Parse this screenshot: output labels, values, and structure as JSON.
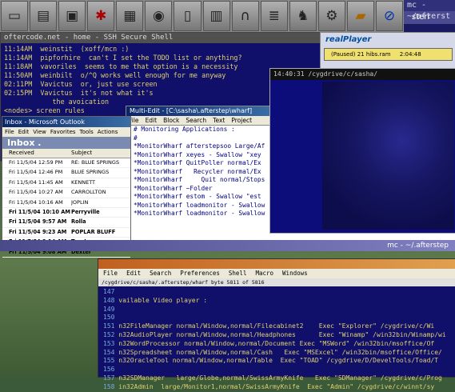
{
  "wharf": {
    "icons": [
      "terminal-icon",
      "drive-icon",
      "monitor-icon",
      "bug-icon",
      "chip-icon",
      "media-icon",
      "document-icon",
      "printer-icon",
      "headphones-icon",
      "notepad-icon",
      "wizard-icon",
      "gear-icon",
      "folder-icon",
      "globe-icon",
      "shield-icon"
    ]
  },
  "mc_top": {
    "title": "mc - ~/afterst",
    "sub": "sterr"
  },
  "ssh": {
    "title": "oftercode.net - home - SSH Secure Shell",
    "lines": [
      "11:14AM  weinstit  (xoff/mcn :)",
      "11:14AM  pipforhire  can't I set the TODO list or anything?",
      "11:18AM  vavoriles  seems to me that option is a necessity",
      "11:50AM  weinbilt  o/^Q works well enough for me anyway",
      "02:11PM  Vavictus  or, just use screen",
      "02:15PM  Vavictus  it's not what it's",
      "            the avoication",
      "<nodes> screen rules"
    ]
  },
  "outlook": {
    "title": "Inbox - Microsoft Outlook",
    "menu": [
      "File",
      "Edit",
      "View",
      "Favorites",
      "Tools",
      "Actions"
    ],
    "inbox": "Inbox .",
    "headers": [
      "Received",
      "Subject"
    ],
    "rows": [
      {
        "d": "Fri 11/5/04 12:59 PM",
        "s": "RE: BLUE SPRINGS",
        "bold": false
      },
      {
        "d": "Fri 11/5/04 12:46 PM",
        "s": "BLUE SPRINGS",
        "bold": false
      },
      {
        "d": "Fri 11/5/04 11:45 AM",
        "s": "KENNETT",
        "bold": false
      },
      {
        "d": "Fri 11/5/04 10:27 AM",
        "s": "CARROLLTON",
        "bold": false
      },
      {
        "d": "Fri 11/5/04 10:16 AM",
        "s": "JOPLIN",
        "bold": false
      },
      {
        "d": "Fri 11/5/04 10:10 AM",
        "s": "Perryville",
        "bold": true
      },
      {
        "d": "Fri 11/5/04 9:57 AM",
        "s": "Rolla",
        "bold": true
      },
      {
        "d": "Fri 11/5/04 9:23 AM",
        "s": "POPLAR BLUFF",
        "bold": true
      },
      {
        "d": "Fri 11/5/04 9:14 AM",
        "s": "Trenton",
        "bold": true
      },
      {
        "d": "Fri 11/5/04 9:08 AM",
        "s": "Dexter",
        "bold": true
      }
    ]
  },
  "real": {
    "logo": "realPlayer",
    "status": "(Paused) 21 hibs.ram",
    "time": "2:04:48"
  },
  "cyg": {
    "title": "14:40:31  /cygdrive/c/sasha/"
  },
  "medit": {
    "title": "Multi-Edit - [C:\\sasha\\.afterstep\\wharf]",
    "menu": [
      "File",
      "Edit",
      "Block",
      "Search",
      "Text",
      "Project"
    ],
    "tab": "wharf"
  },
  "code": {
    "lines": [
      "# Monitoring Applications :",
      "#",
      "",
      "*MonitorWharf afterstepsoo Large/Af",
      "*MonitorWharf xeyes - Swallow \"xey",
      "",
      "*MonitorWharf QuitPoller normal/Ex",
      "*MonitorWharf   Recycler normal/Ex",
      "*MonitorWharf     Quit normal/Stops",
      "*MonitorWharf ~Folder",
      "",
      "*MonitorWharf estom - Swallow \"est",
      "*MonitorWharf loadmonitor - Swallow \"wmbyload\" wmbyload -ll -w c",
      "*MonitorWharf loadmonitor - Swallow \"wmbyload\" wmbyload -ll -w c"
    ]
  },
  "mcbar": {
    "label": "mc - ~/.afterstep"
  },
  "bedit": {
    "title": "",
    "menu": [
      "File",
      "Edit",
      "Search",
      "Preferences",
      "Shell",
      "Macro",
      "Windows"
    ],
    "path": "/cygdrive/c/sasha/.afterstep/wharf byte 5811 of 5816",
    "lines": [
      {
        "n": "147",
        "t": ""
      },
      {
        "n": "148",
        "t": "vailable Video player :"
      },
      {
        "n": "149",
        "t": ""
      },
      {
        "n": "150",
        "t": ""
      },
      {
        "n": "151",
        "t": "n32FileManager normal/Window,normal/Filecabinet2    Exec \"Explorer\" /cygdrive/c/Wi"
      },
      {
        "n": "152",
        "t": "n32AudioPlayer normal/Window,normal/Headphones      Exec \"Winamp\" /win32bin/Winamp/wi"
      },
      {
        "n": "153",
        "t": "n32WordProcessor normal/Window,normal/Document Exec \"MSWord\" /win32bin/msoffice/Of"
      },
      {
        "n": "154",
        "t": "n32Spreadsheet normal/Window,normal/Cash   Exec \"MSExcel\" /win32bin/msoffice/Office/"
      },
      {
        "n": "155",
        "t": "n32OracleTool normal/Window,normal/Table  Exec \"TOAD\" /cygdrive/D/DevelTools/Toad/T"
      },
      {
        "n": "156",
        "t": ""
      },
      {
        "n": "157",
        "t": "n32SDManager   large/Globe,normal/SwissArmyKnife   Exec \"SDManager\" /cygdrive/c/Prog"
      },
      {
        "n": "158",
        "t": "in32Admin  large/Monitor1,normal/SwissArmyKnife  Exec \"Admin\" /cygdrive/c/winnt/sy"
      }
    ]
  }
}
